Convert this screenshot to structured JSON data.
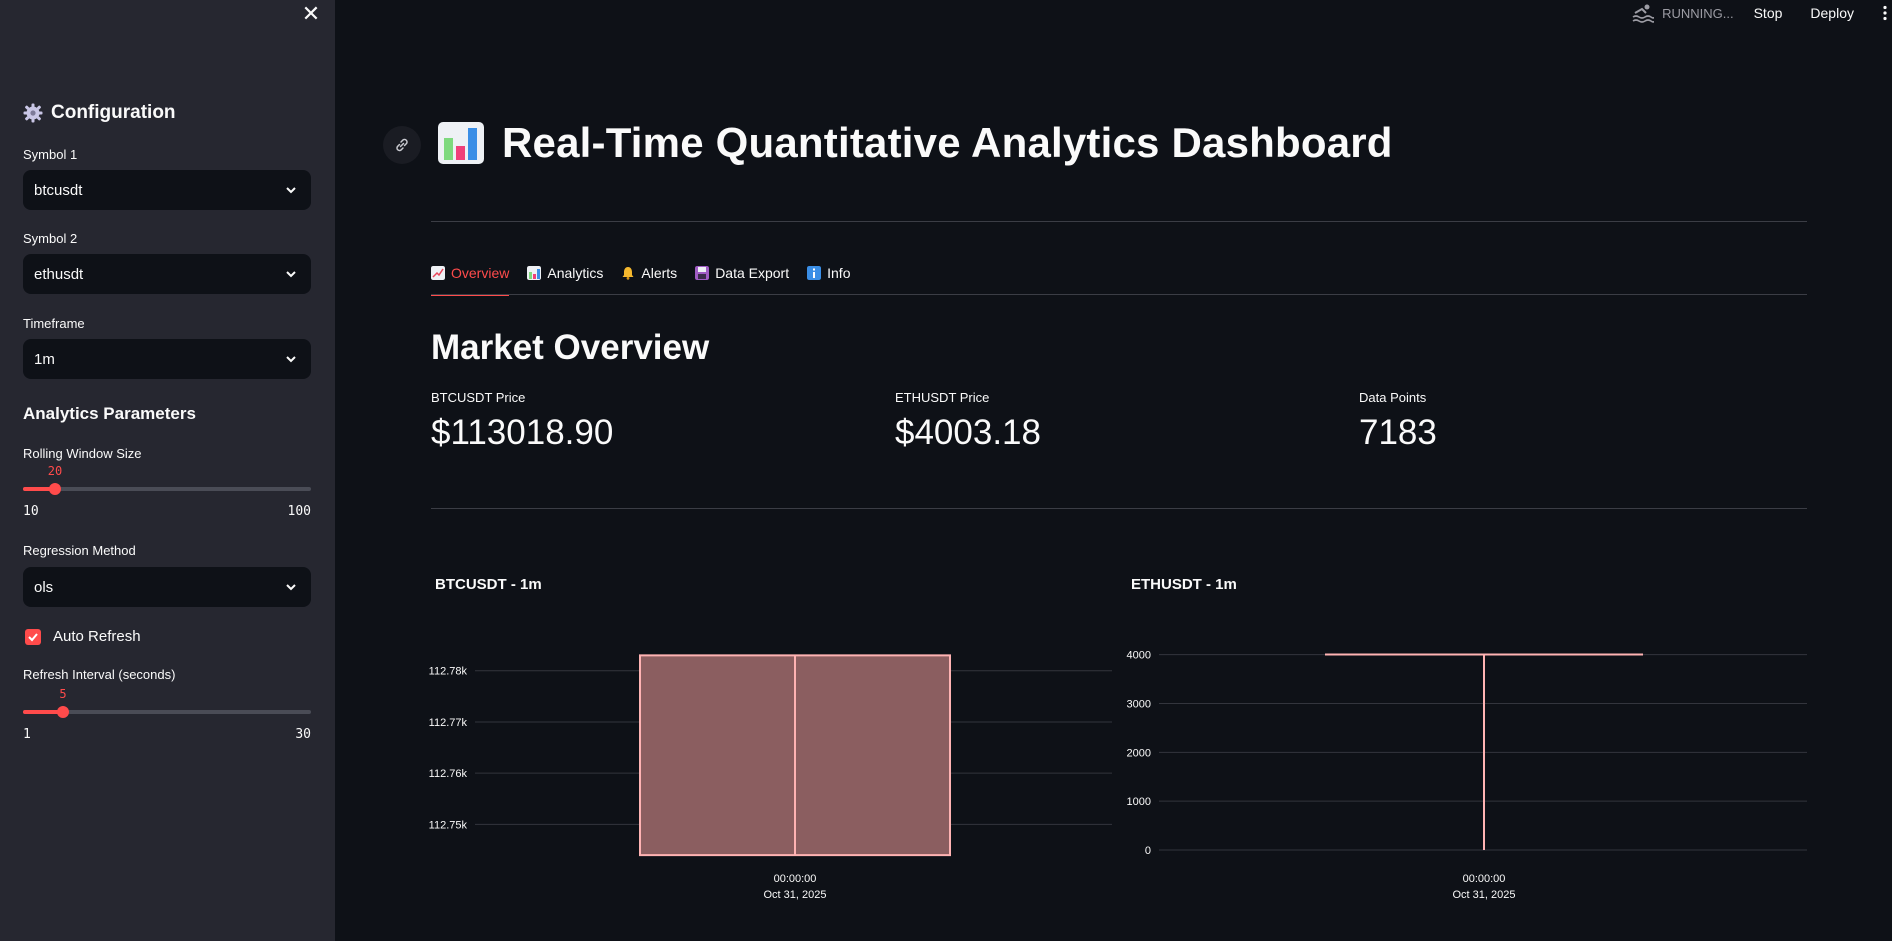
{
  "sidebar": {
    "close_icon": "close-icon",
    "config_heading": "Configuration",
    "symbol1": {
      "label": "Symbol 1",
      "value": "btcusdt"
    },
    "symbol2": {
      "label": "Symbol 2",
      "value": "ethusdt"
    },
    "timeframe": {
      "label": "Timeframe",
      "value": "1m"
    },
    "analytics_heading": "Analytics Parameters",
    "rolling_window": {
      "label": "Rolling Window Size",
      "value": "20",
      "min": "10",
      "max": "100"
    },
    "regression": {
      "label": "Regression Method",
      "value": "ols"
    },
    "auto_refresh": {
      "label": "Auto Refresh",
      "checked": true
    },
    "refresh_interval": {
      "label": "Refresh Interval (seconds)",
      "value": "5",
      "min": "1",
      "max": "30"
    }
  },
  "header": {
    "status": "RUNNING...",
    "stop": "Stop",
    "deploy": "Deploy"
  },
  "main": {
    "title": "Real-Time Quantitative Analytics Dashboard",
    "tabs": [
      {
        "label": "Overview",
        "icon": "chart-increasing-icon",
        "active": true
      },
      {
        "label": "Analytics",
        "icon": "bar-chart-icon",
        "active": false
      },
      {
        "label": "Alerts",
        "icon": "bell-icon",
        "active": false
      },
      {
        "label": "Data Export",
        "icon": "floppy-disk-icon",
        "active": false
      },
      {
        "label": "Info",
        "icon": "info-icon",
        "active": false
      }
    ],
    "section_title": "Market Overview",
    "metrics": [
      {
        "label": "BTCUSDT Price",
        "value": "$113018.90"
      },
      {
        "label": "ETHUSDT Price",
        "value": "$4003.18"
      },
      {
        "label": "Data Points",
        "value": "7183"
      }
    ]
  },
  "colors": {
    "accent": "#ff4b4b",
    "candle_fill": "#8b5e60",
    "candle_line": "#ffb3b3"
  },
  "chart_data": [
    {
      "type": "candlestick",
      "title": "BTCUSDT - 1m",
      "x_tick": [
        "00:00:00",
        "Oct 31, 2025"
      ],
      "y_ticks": [
        "112.75k",
        "112.76k",
        "112.77k",
        "112.78k"
      ],
      "ylim": [
        112745,
        112786
      ],
      "candles": [
        {
          "x": "Oct 31, 2025 00:00:00",
          "open": 112744,
          "close": 112783,
          "high": 112783,
          "low": 112744
        }
      ]
    },
    {
      "type": "candlestick",
      "title": "ETHUSDT - 1m",
      "x_tick": [
        "00:00:00",
        "Oct 31, 2025"
      ],
      "y_ticks": [
        "0",
        "1000",
        "2000",
        "3000",
        "4000"
      ],
      "ylim": [
        0,
        4300
      ],
      "candles": [
        {
          "x": "Oct 31, 2025 00:00:00",
          "open": 4003,
          "close": 4003,
          "high": 4003,
          "low": 0
        }
      ]
    }
  ]
}
